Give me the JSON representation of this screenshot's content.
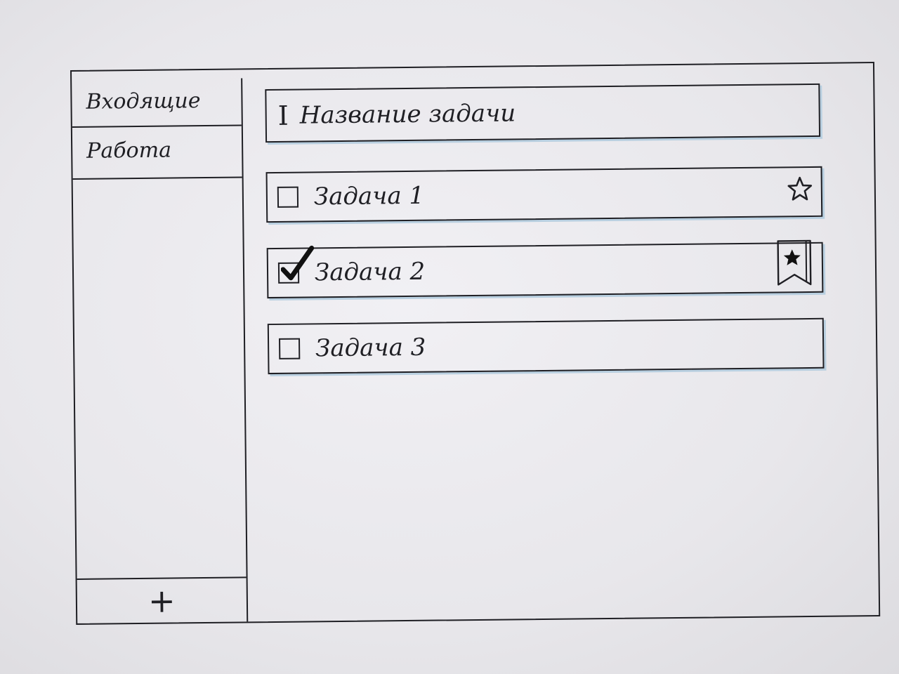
{
  "sidebar": {
    "items": [
      {
        "label": "Входящие"
      },
      {
        "label": "Работа"
      }
    ],
    "add_button_label": "+"
  },
  "main": {
    "new_task": {
      "cursor_glyph": "I",
      "placeholder": "Название задачи"
    },
    "tasks": [
      {
        "label": "Задача 1",
        "checked": false,
        "starred": false,
        "icon": "star-outline-icon"
      },
      {
        "label": "Задача 2",
        "checked": true,
        "starred": true,
        "icon": "bookmark-star-icon"
      },
      {
        "label": "Задача 3",
        "checked": false,
        "starred": false,
        "icon": ""
      }
    ]
  }
}
